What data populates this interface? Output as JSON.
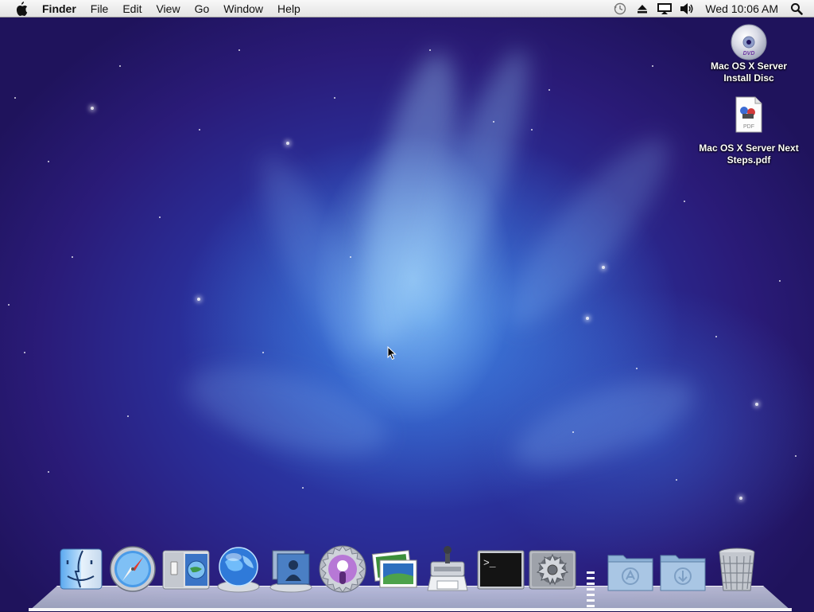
{
  "menubar": {
    "app_name": "Finder",
    "menus": [
      "File",
      "Edit",
      "View",
      "Go",
      "Window",
      "Help"
    ],
    "extras": [
      "time-machine-icon",
      "eject-icon",
      "display-icon",
      "volume-icon"
    ],
    "clock": "Wed 10:06 AM"
  },
  "desktop": {
    "icons": [
      {
        "name": "dvd-disc-icon",
        "label_lines": [
          "Mac OS X Server",
          "Install Disc"
        ]
      },
      {
        "name": "pdf-document-icon",
        "label_lines": [
          "Mac OS X Server Next",
          "Steps.pdf"
        ],
        "pdf_badge": "PDF"
      }
    ]
  },
  "dock": {
    "apps": [
      "finder-icon",
      "safari-icon",
      "server-preferences-icon",
      "server-admin-icon",
      "workgroup-manager-icon",
      "podcast-producer-icon",
      "preview-icon",
      "system-image-utility-icon",
      "terminal-icon",
      "system-preferences-icon"
    ],
    "stacks": [
      "applications-folder-icon",
      "downloads-folder-icon",
      "trash-icon"
    ],
    "terminal_prompt": ">_"
  },
  "colors": {
    "menubar_bg": "#eeeeee",
    "wallpaper_mid": "#2d4fc0",
    "wallpaper_edge": "#1f135c"
  }
}
